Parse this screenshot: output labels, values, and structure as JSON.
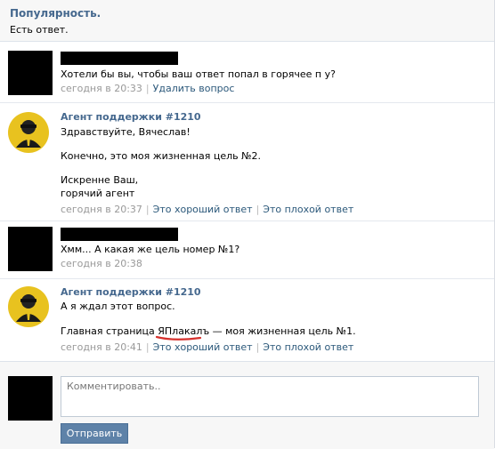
{
  "header": {
    "title": "Популярность.",
    "subtitle": "Есть ответ."
  },
  "messages": [
    {
      "author": "",
      "lines": [
        "Хотели бы вы, чтобы ваш ответ попал в горячее п        у?"
      ],
      "time": "сегодня в 20:33",
      "actions": [
        "Удалить вопрос"
      ]
    },
    {
      "author": "Агент поддержки #1210",
      "lines": [
        "Здравствуйте, Вячеслав!",
        "Конечно, это моя жизненная цель №2.",
        "Искренне Ваш,",
        "горячий агент"
      ],
      "time": "сегодня в 20:37",
      "actions": [
        "Это хороший ответ",
        "Это плохой ответ"
      ]
    },
    {
      "author": "",
      "lines": [
        "Хмм... А какая же цель номер №1?"
      ],
      "time": "сегодня в 20:38",
      "actions": []
    },
    {
      "author": "Агент поддержки #1210",
      "lines": [
        "А я ждал этот вопрос."
      ],
      "main_line": {
        "before": "Главная страница ",
        "highlight": "ЯПлакалъ",
        "after": " — моя жизненная цель №1."
      },
      "time": "сегодня в 20:41",
      "actions": [
        "Это хороший ответ",
        "Это плохой ответ"
      ]
    }
  ],
  "composer": {
    "placeholder": "Комментировать..",
    "send_label": "Отправить"
  },
  "colors": {
    "link": "#2b587a",
    "author": "#45688e",
    "button": "#5e82a8",
    "underline": "#d6302c"
  }
}
